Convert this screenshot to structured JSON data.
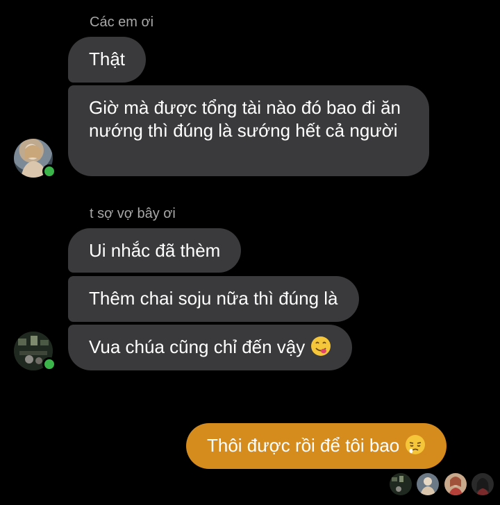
{
  "groups": [
    {
      "sender": "Các em ơi",
      "messages": [
        "Thật",
        "Giờ mà được tổng tài nào đó bao đi ăn nướng thì đúng là sướng hết cả người"
      ]
    },
    {
      "sender": "t sợ vợ bây ơi",
      "messages": [
        "Ui nhắc đã thèm",
        "Thêm chai soju nữa thì đúng là",
        "Vua chúa cũng chỉ đến vậy"
      ]
    }
  ],
  "outgoing": {
    "text": "Thôi được rồi để tôi bao"
  },
  "emojis": {
    "incoming_last": "face-savoring-food-emoji",
    "outgoing": "sleepy-face-emoji"
  },
  "colors": {
    "background": "#000000",
    "incoming_bubble": "#3a3a3c",
    "outgoing_bubble": "#d68c1c",
    "online_dot": "#3bb44a",
    "sender_name": "#a8a8a8"
  }
}
